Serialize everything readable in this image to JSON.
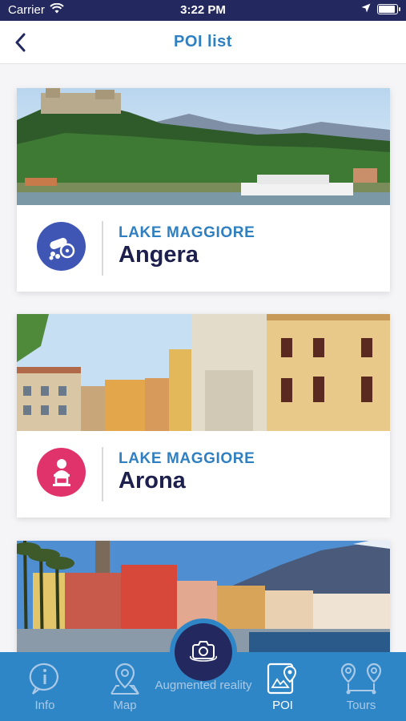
{
  "status_bar": {
    "carrier": "Carrier",
    "time": "3:22 PM"
  },
  "nav": {
    "title": "POI list"
  },
  "pois": [
    {
      "region": "LAKE MAGGIORE",
      "name": "Angera",
      "icon": "cannon-icon",
      "icon_color": "#3f56b5"
    },
    {
      "region": "LAKE MAGGIORE",
      "name": "Arona",
      "icon": "statue-icon",
      "icon_color": "#e0336b"
    }
  ],
  "tabs": {
    "info": "Info",
    "map": "Map",
    "ar": "Augmented reality",
    "poi": "POI",
    "tours": "Tours",
    "active": "POI"
  },
  "colors": {
    "accent": "#2f7fc1",
    "dark": "#23285e",
    "tabbar": "#2f86c7"
  }
}
